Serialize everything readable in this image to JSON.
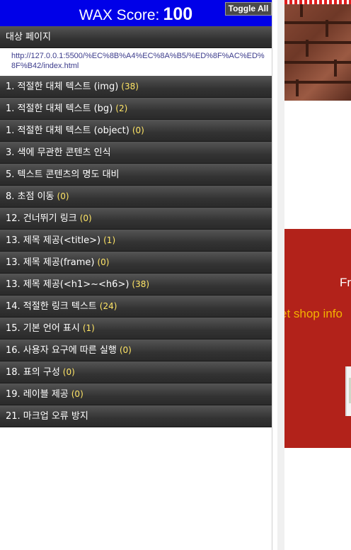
{
  "wax": {
    "score_label": "WAX Score:",
    "score_value": "100",
    "toggle_label": "Toggle All",
    "page_section_title": "대상 페이지",
    "page_url": "http://127.0.0.1:5500/%EC%8B%A4%EC%8A%B5/%ED%8F%AC%ED%8F%B42/index.html",
    "items": [
      {
        "label": "1. 적절한 대체 텍스트 (img)",
        "count": "(38)"
      },
      {
        "label": "1. 적절한 대체 텍스트 (bg)",
        "count": "(2)"
      },
      {
        "label": "1. 적절한 대체 텍스트 (object)",
        "count": "(0)"
      },
      {
        "label": "3. 색에 무관한 콘텐츠 인식",
        "count": ""
      },
      {
        "label": "5. 텍스트 콘텐츠의 명도 대비",
        "count": ""
      },
      {
        "label": "8. 초점 이동",
        "count": "(0)"
      },
      {
        "label": "12. 건너뛰기 링크",
        "count": "(0)"
      },
      {
        "label": "13. 제목 제공(<title>)",
        "count": "(1)"
      },
      {
        "label": "13. 제목 제공(frame)",
        "count": "(0)"
      },
      {
        "label": "13. 제목 제공(<h1>~<h6>)",
        "count": "(38)"
      },
      {
        "label": "14. 적절한 링크 텍스트",
        "count": "(24)"
      },
      {
        "label": "15. 기본 언어 표시",
        "count": "(1)"
      },
      {
        "label": "16. 사용자 요구에 따른 실행",
        "count": "(0)"
      },
      {
        "label": "18. 표의 구성",
        "count": "(0)"
      },
      {
        "label": "19. 레이블 제공",
        "count": "(0)"
      },
      {
        "label": "21. 마크업 오류 방지",
        "count": ""
      }
    ]
  },
  "background_page": {
    "promo_text_1": "Fr",
    "promo_text_2": "et shop info"
  },
  "colors": {
    "score_bar": "#0000e8",
    "section_header": "#333333",
    "count_text": "#ffe566",
    "promo_red": "#b2221a",
    "promo_orange": "#f3b200"
  }
}
